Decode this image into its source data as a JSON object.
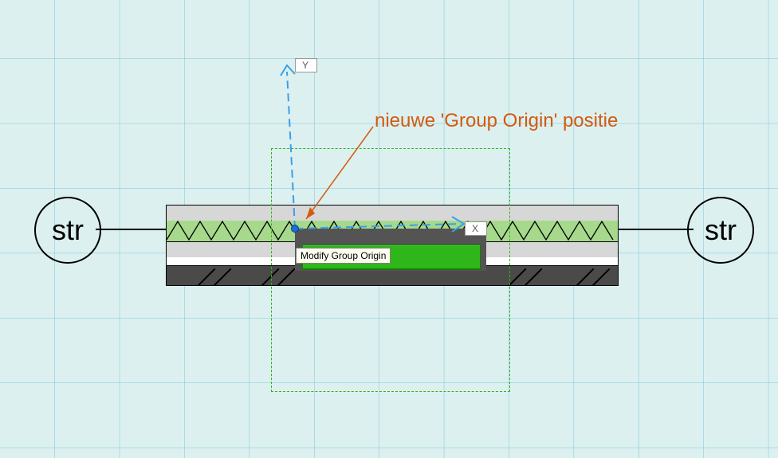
{
  "axis": {
    "x_label": "X",
    "y_label": "Y"
  },
  "grid_bubble_label": "str",
  "tooltip": {
    "text": "Modify Group Origin"
  },
  "annotation": {
    "text": "nieuwe 'Group Origin' positie"
  },
  "colors": {
    "selection_green": "#2fb61a",
    "annotation": "#d35a0e",
    "ucs_blue": "#1a6fd6"
  }
}
